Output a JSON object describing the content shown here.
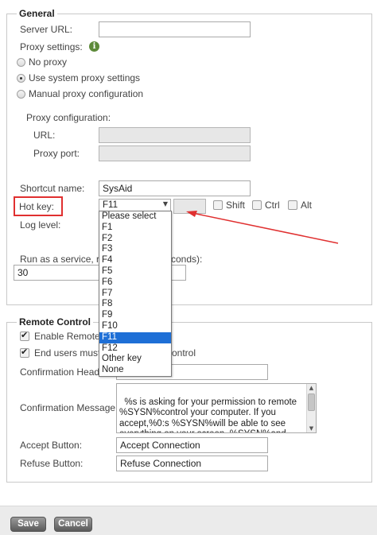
{
  "general": {
    "legend": "General",
    "server_url_label": "Server URL:",
    "server_url_value": "",
    "proxy_settings_label": "Proxy settings:",
    "info_icon": "info-icon",
    "proxy_options": {
      "no_proxy": "No proxy",
      "system_proxy": "Use system proxy settings",
      "manual_proxy": "Manual proxy configuration",
      "selected": "system_proxy"
    },
    "proxy_configuration_label": "Proxy configuration:",
    "url_label": "URL:",
    "proxy_port_label": "Proxy port:",
    "shortcut_name_label": "Shortcut name:",
    "shortcut_name_value": "SysAid",
    "hot_key_label": "Hot key:",
    "hot_key_selected": "F11",
    "shift_label": "Shift",
    "ctrl_label": "Ctrl",
    "alt_label": "Alt",
    "log_level_label": "Log level:",
    "service_label_left": "Run as a service, re",
    "service_label_right": "conds):",
    "service_value": "30"
  },
  "hot_key_options": [
    "Please select",
    "F1",
    "F2",
    "F3",
    "F4",
    "F5",
    "F6",
    "F7",
    "F8",
    "F9",
    "F10",
    "F11",
    "F12",
    "Other key",
    "None"
  ],
  "remote_control": {
    "legend": "Remote Control",
    "enable_label": "Enable Remote",
    "end_users_label": "End users must",
    "end_users_label_right": "ontrol",
    "confirmation_header_label": "Confirmation Heade",
    "confirmation_header_value": "",
    "confirmation_message_label": "Confirmation Message:",
    "confirmation_message_value": "%s is asking for your permission to remote %SYSN%control your computer. If you accept,%0:s %SYSN%will be able to see everything on your screen, %SYSN%and control it",
    "accept_button_label": "Accept Button:",
    "accept_button_value": "Accept Connection",
    "refuse_button_label": "Refuse Button:",
    "refuse_button_value": "Refuse Connection"
  },
  "footer": {
    "save_label": "Save",
    "cancel_label": "Cancel"
  },
  "colors": {
    "highlight": "#e03030",
    "selected_item": "#1e6fd6"
  }
}
